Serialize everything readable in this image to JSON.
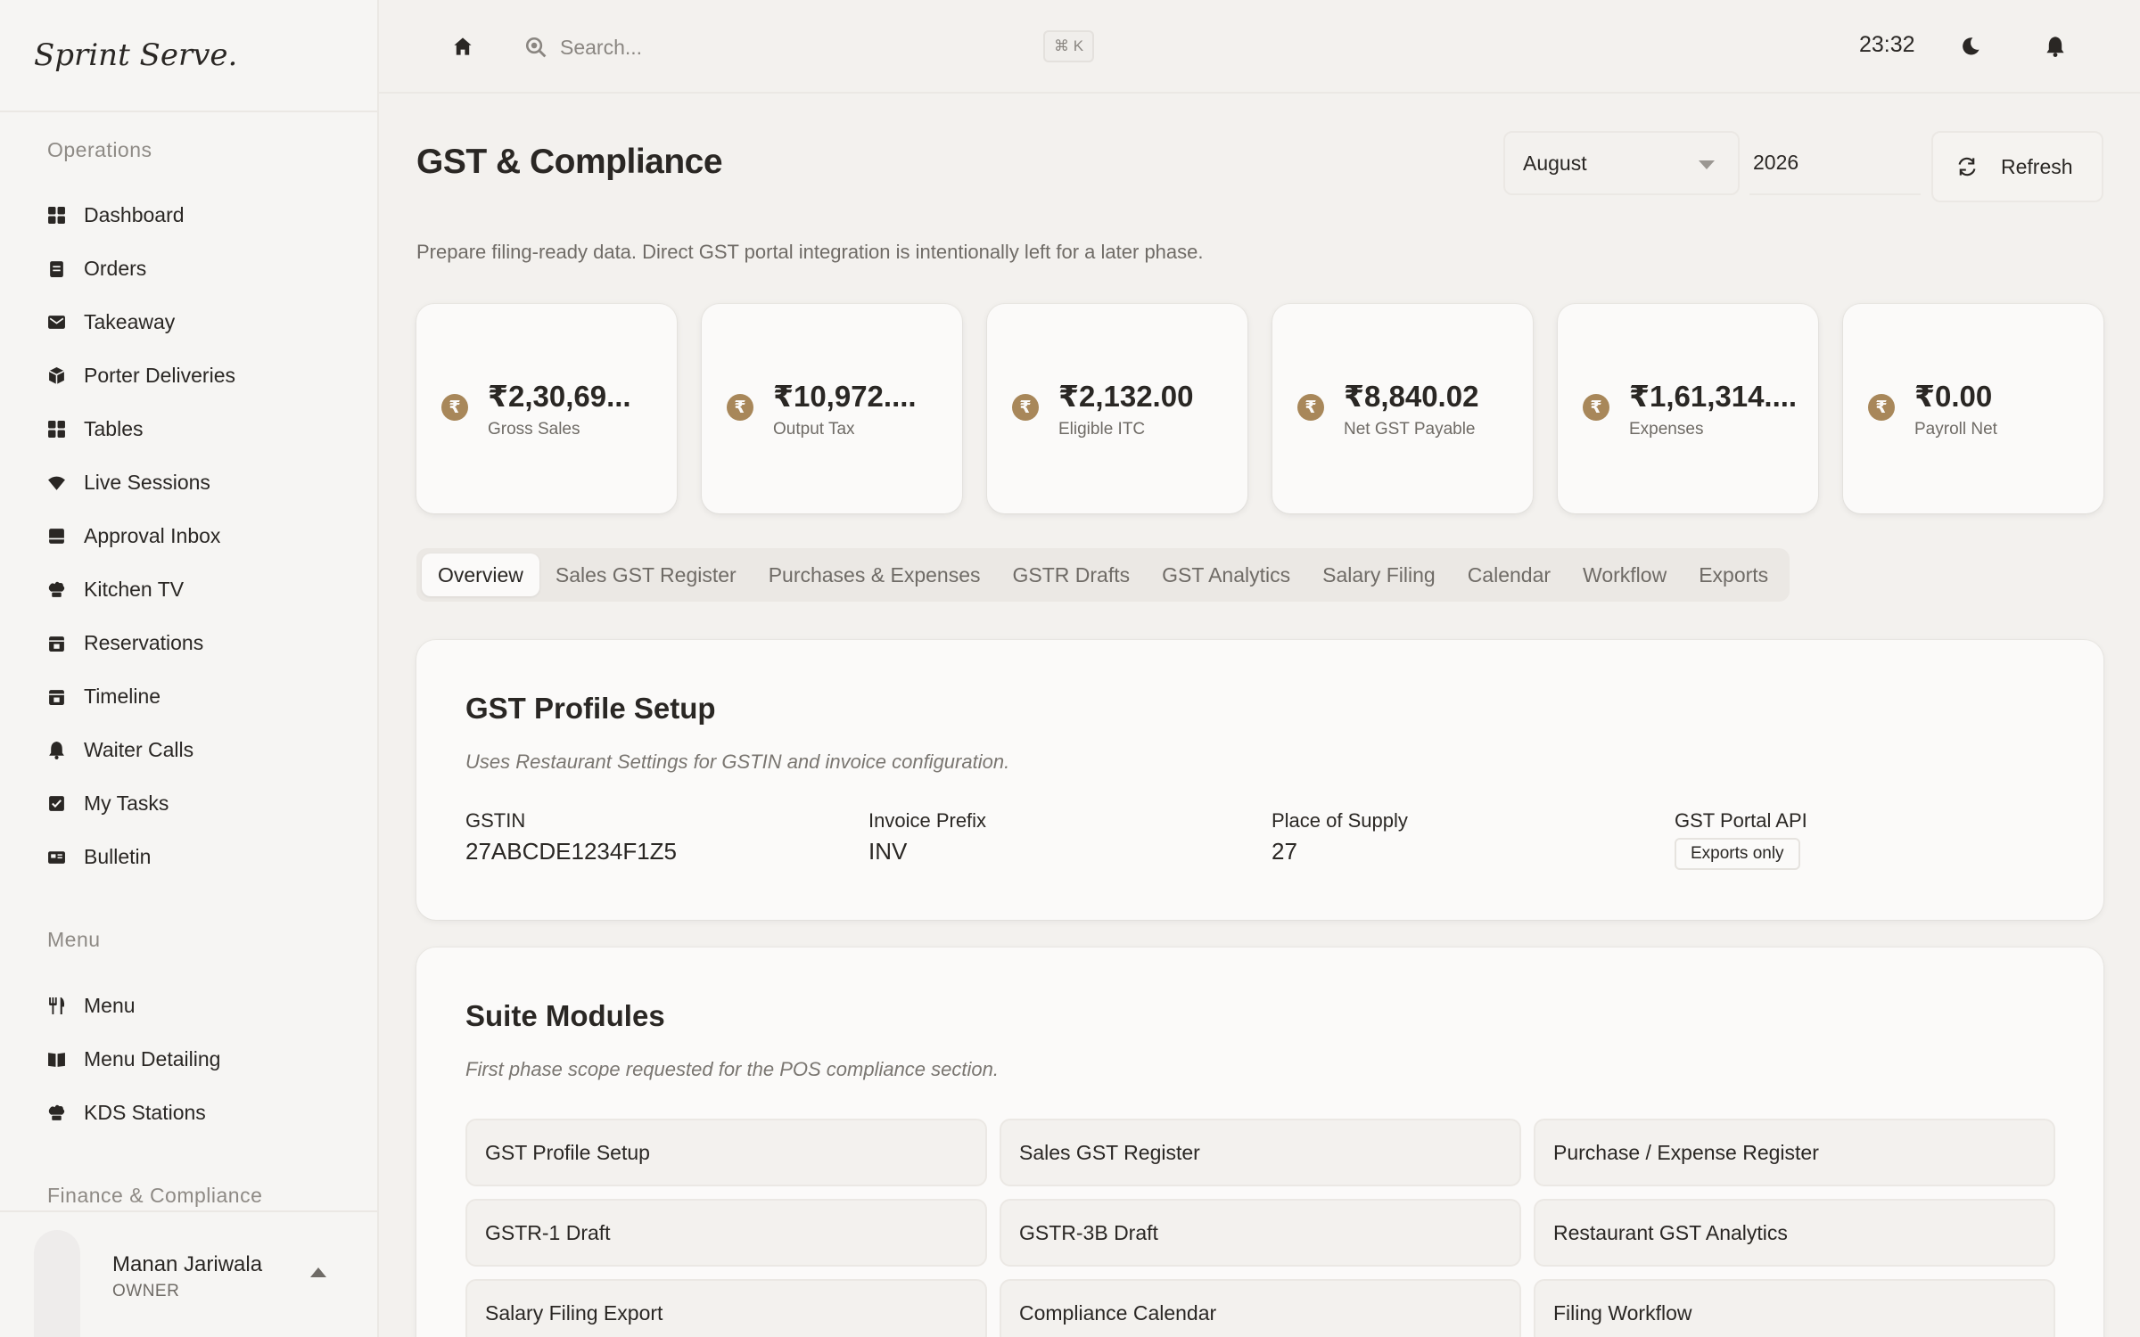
{
  "brand": "Sprint Serve.",
  "sidebar": {
    "sections": [
      {
        "label": "Operations"
      },
      {
        "label": "Menu"
      },
      {
        "label": "Finance & Compliance"
      }
    ],
    "items": [
      {
        "label": "Dashboard",
        "icon": "grid-icon"
      },
      {
        "label": "Orders",
        "icon": "clipboard-icon"
      },
      {
        "label": "Takeaway",
        "icon": "mail-icon"
      },
      {
        "label": "Porter Deliveries",
        "icon": "box-icon"
      },
      {
        "label": "Tables",
        "icon": "grid-icon"
      },
      {
        "label": "Live Sessions",
        "icon": "wifi-icon"
      },
      {
        "label": "Approval Inbox",
        "icon": "inbox-icon"
      },
      {
        "label": "Kitchen TV",
        "icon": "chef-hat-icon"
      },
      {
        "label": "Reservations",
        "icon": "calendar-icon"
      },
      {
        "label": "Timeline",
        "icon": "calendar-icon"
      },
      {
        "label": "Waiter Calls",
        "icon": "bell-icon"
      },
      {
        "label": "My Tasks",
        "icon": "checkbox-icon"
      },
      {
        "label": "Bulletin",
        "icon": "newspaper-icon"
      },
      {
        "label": "Menu",
        "icon": "utensils-icon"
      },
      {
        "label": "Menu Detailing",
        "icon": "book-icon"
      },
      {
        "label": "KDS Stations",
        "icon": "chef-hat-icon"
      }
    ]
  },
  "user": {
    "name": "Manan Jariwala",
    "role": "OWNER"
  },
  "topbar": {
    "search_placeholder": "Search...",
    "shortcut": "⌘ K",
    "time": "23:32"
  },
  "page": {
    "title": "GST & Compliance",
    "subtitle": "Prepare filing-ready data. Direct GST portal integration is intentionally left for a later phase.",
    "month": "August",
    "year": "2026",
    "refresh_label": "Refresh"
  },
  "stats": [
    {
      "value": "₹2,30,69...",
      "label": "Gross Sales"
    },
    {
      "value": "₹10,972....",
      "label": "Output Tax"
    },
    {
      "value": "₹2,132.00",
      "label": "Eligible ITC"
    },
    {
      "value": "₹8,840.02",
      "label": "Net GST Payable"
    },
    {
      "value": "₹1,61,314....",
      "label": "Expenses"
    },
    {
      "value": "₹0.00",
      "label": "Payroll Net"
    }
  ],
  "currency_symbol": "₹",
  "tabs": [
    "Overview",
    "Sales GST Register",
    "Purchases & Expenses",
    "GSTR Drafts",
    "GST Analytics",
    "Salary Filing",
    "Calendar",
    "Workflow",
    "Exports"
  ],
  "active_tab": "Overview",
  "profile": {
    "title": "GST Profile Setup",
    "description": "Uses Restaurant Settings for GSTIN and invoice configuration.",
    "fields": [
      {
        "label": "GSTIN",
        "value": "27ABCDE1234F1Z5"
      },
      {
        "label": "Invoice Prefix",
        "value": "INV"
      },
      {
        "label": "Place of Supply",
        "value": "27"
      },
      {
        "label": "GST Portal API",
        "value": "Exports only"
      }
    ]
  },
  "modules": {
    "title": "Suite Modules",
    "description": "First phase scope requested for the POS compliance section.",
    "items": [
      "GST Profile Setup",
      "Sales GST Register",
      "Purchase / Expense Register",
      "GSTR-1 Draft",
      "GSTR-3B Draft",
      "Restaurant GST Analytics",
      "Salary Filing Export",
      "Compliance Calendar",
      "Filing Workflow"
    ]
  },
  "colors": {
    "accent": "#a8875a",
    "background": "#f3f1ee",
    "card": "#fbfaf9"
  }
}
